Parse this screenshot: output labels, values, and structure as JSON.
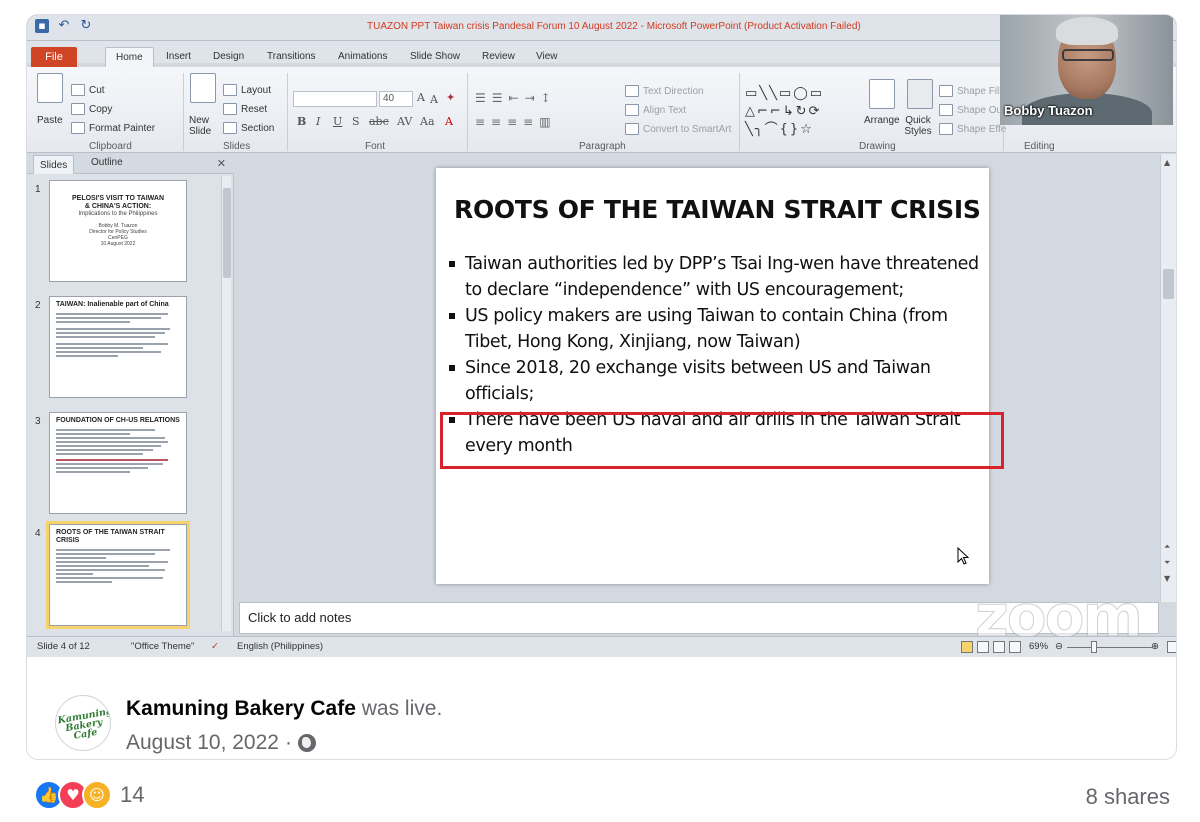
{
  "window": {
    "title": "TUAZON PPT Taiwan crisis Pandesal Forum 10 August 2022  -  Microsoft PowerPoint (Product Activation Failed)"
  },
  "ribbon": {
    "tabs": [
      "File",
      "Home",
      "Insert",
      "Design",
      "Transitions",
      "Animations",
      "Slide Show",
      "Review",
      "View"
    ],
    "clipboard": {
      "paste": "Paste",
      "cut": "Cut",
      "copy": "Copy",
      "format_painter": "Format Painter",
      "label": "Clipboard"
    },
    "slides": {
      "new_slide": "New Slide",
      "layout": "Layout",
      "reset": "Reset",
      "section": "Section",
      "label": "Slides"
    },
    "font": {
      "size": "40",
      "label": "Font"
    },
    "paragraph": {
      "text_direction": "Text Direction",
      "align_text": "Align Text",
      "smartart": "Convert to SmartArt",
      "label": "Paragraph"
    },
    "drawing": {
      "arrange": "Arrange",
      "quick_styles": "Quick Styles",
      "shape_fill": "Shape Fill",
      "shape_outline": "Shape Out",
      "shape_effects": "Shape Effe",
      "label": "Drawing"
    },
    "editing": {
      "label": "Editing"
    }
  },
  "pane": {
    "tabs": [
      "Slides",
      "Outline"
    ],
    "thumbnails": [
      {
        "num": "1",
        "lines": [
          "PELOSI'S VISIT TO TAIWAN",
          "& CHINA'S ACTION:",
          "Implications to the Philippines",
          "Bobby M. Tuazon",
          "Director for Policy Studies",
          "CenPEG",
          "10 August 2022"
        ]
      },
      {
        "num": "2",
        "title": "TAIWAN:  Inalienable part of China"
      },
      {
        "num": "3",
        "title": "FOUNDATION OF CH-US RELATIONS"
      },
      {
        "num": "4",
        "title": "ROOTS OF THE TAIWAN STRAIT CRISIS"
      }
    ]
  },
  "slide": {
    "title": "ROOTS OF THE TAIWAN STRAIT CRISIS",
    "bullets": [
      "Taiwan authorities led by DPP’s Tsai Ing-wen have threatened to declare “independence” with US encouragement;",
      "US policy makers are using Taiwan to contain China (from Tibet, Hong Kong, Xinjiang, now Taiwan)",
      "Since 2018, 20 exchange visits between US and Taiwan officials;",
      "There have been US naval and air drills in the Taiwan Strait every month"
    ]
  },
  "notes": {
    "placeholder": "Click to add notes"
  },
  "watermark": "zoom",
  "status": {
    "slide": "Slide 4 of 12",
    "theme": "\"Office Theme\"",
    "language": "English (Philippines)",
    "zoom": "69%"
  },
  "webcam": {
    "name": "Bobby Tuazon"
  },
  "post": {
    "avatar_text": "Kamuning Bakery Cafe",
    "page_name": "Kamuning Bakery Cafe",
    "action": "was live.",
    "date": "August 10, 2022",
    "date_sep": "·",
    "reaction_count": "14",
    "shares": "8 shares"
  },
  "colors": {
    "accent": "#1877f2",
    "file_tab": "#d04525",
    "highlight_box": "#d8232a"
  }
}
